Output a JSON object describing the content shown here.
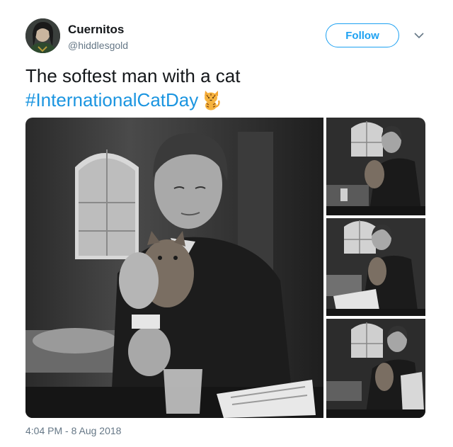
{
  "user": {
    "display_name": "Cuernitos",
    "handle": "@hiddlesgold"
  },
  "follow_label": "Follow",
  "tweet": {
    "text": "The softest man with a cat",
    "hashtag": "#InternationalCatDay",
    "emoji": "tiger-cat-emoji"
  },
  "media": {
    "photo_count": 4
  },
  "timestamp": "4:04 PM - 8 Aug 2018",
  "colors": {
    "accent": "#1da1f2",
    "hashtag": "#1b95e0",
    "secondary_text": "#657786",
    "text": "#14171a"
  }
}
